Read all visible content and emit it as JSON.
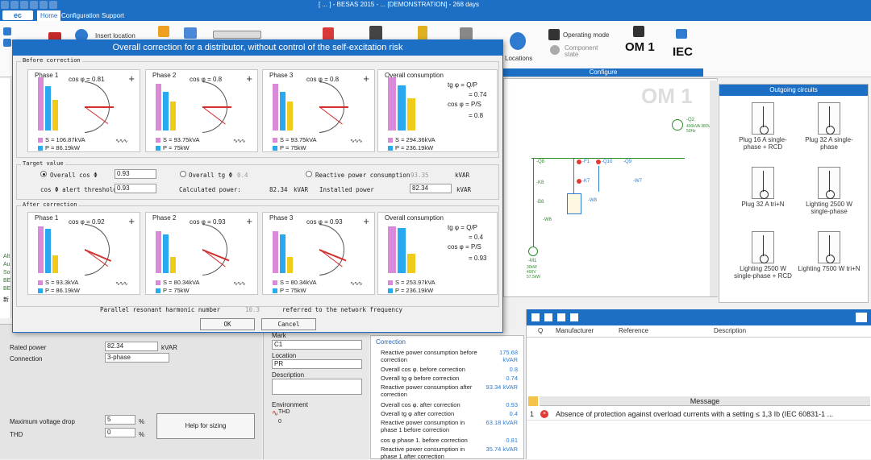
{
  "window": {
    "title": "[ ... ] - BESAS 2015 - ... [DEMONSTRATION] - 268 days"
  },
  "menu": {
    "logo": "ec",
    "home": "Home",
    "configuration": "Configuration",
    "support": "Support"
  },
  "ribbon": {
    "insert_location": "Insert location",
    "locations": "Locations",
    "operating_mode": "Operating mode",
    "component_state": "Component state",
    "om1": "OM 1",
    "iec": "IEC",
    "configure": "Configure"
  },
  "canvas": {
    "watermark": "OM 1",
    "labels": {
      "q8": "-Q8",
      "f1": "-F1",
      "q10": "-Q10",
      "q9": "-Q9",
      "k8": "-K8",
      "k7": "-K7",
      "w8": "-W8",
      "w7": "-W7",
      "b8": "-B8",
      "w6": "-W6",
      "m1": "-M1",
      "q2": "-Q2",
      "q2spec": "400kVA 380V 50Hz",
      "motor": "30kW 400V 57.5kW"
    }
  },
  "left_panel": {
    "labels": [
      "Alt",
      "Au",
      "So",
      "BE",
      "BE",
      "新"
    ]
  },
  "outgoing": {
    "title": "Outgoing circuits",
    "items": [
      "Plug 16 A single-phase + RCD",
      "Plug 32 A single-phase",
      "Plug 32 A tri+N",
      "Lighting 2500 W single-phase",
      "Lighting 2500 W single-phase + RCD",
      "Lighting 7500 W tri+N"
    ]
  },
  "dialog": {
    "title": "Overall correction for a distributor, without control of the self-excitation risk",
    "before_label": "Before correction",
    "target_label": "Target value",
    "after_label": "After correction",
    "before": [
      {
        "name": "Phase 1",
        "cos": "cos φ = 0.81",
        "s": "S = 106.87kVA",
        "p": "P = 86.19kW"
      },
      {
        "name": "Phase 2",
        "cos": "cos φ = 0.8",
        "s": "S = 93.75kVA",
        "p": "P = 75kW"
      },
      {
        "name": "Phase 3",
        "cos": "cos φ = 0.8",
        "s": "S = 93.75kVA",
        "p": "P = 75kW"
      }
    ],
    "before_overall": {
      "name": "Overall consumption",
      "tg_formula": "tg φ = Q/P",
      "tg_value": "= 0.74",
      "cos_formula": "cos φ = P/S",
      "cos_value": "= 0.8",
      "s": "S = 294.36kVA",
      "p": "P = 236.19kW"
    },
    "after": [
      {
        "name": "Phase 1",
        "cos": "cos φ = 0.92",
        "s": "S = 93.3kVA",
        "p": "P = 86.19kW"
      },
      {
        "name": "Phase 2",
        "cos": "cos φ = 0.93",
        "s": "S = 80.34kVA",
        "p": "P = 75kW"
      },
      {
        "name": "Phase 3",
        "cos": "cos φ = 0.93",
        "s": "S = 80.34kVA",
        "p": "P = 75kW"
      }
    ],
    "after_overall": {
      "name": "Overall consumption",
      "tg_formula": "tg φ = Q/P",
      "tg_value": "= 0.4",
      "cos_formula": "cos φ = P/S",
      "cos_value": "= 0.93",
      "s": "S = 253.97kVA",
      "p": "P = 236.19kW"
    },
    "target": {
      "overall_cos_label": "Overall cos Φ",
      "overall_cos_value": "0.93",
      "overall_tg_label": "Overall tg Φ",
      "overall_tg_value": "0.4",
      "reactive_label": "Reactive power consumption",
      "reactive_value": "93.35",
      "kvar": "kVAR",
      "alert_label": "cos Φ alert threshold",
      "alert_value": "0.93",
      "calc_label": "Calculated power:",
      "calc_value": "82.34",
      "calc_unit": "kVAR",
      "installed_label": "Installed power",
      "installed_value": "82.34",
      "installed_unit": "kVAR"
    },
    "harmonic_label": "Parallel resonant harmonic number",
    "harmonic_value": "10.3",
    "harmonic_suffix": "referred to the network frequency",
    "ok": "OK",
    "cancel": "Cancel"
  },
  "properties": {
    "rated_power_label": "Rated power",
    "rated_power_value": "82.34",
    "rated_power_unit": "kVAR",
    "connection_label": "Connection",
    "connection_value": "3-phase",
    "max_vd_label": "Maximum voltage drop",
    "max_vd_value": "5",
    "pct": "%",
    "thd_label": "THD",
    "thd_value": "0",
    "help_button": "Help for sizing"
  },
  "mid_panel": {
    "mark_label": "Mark",
    "mark_value": "C1",
    "location_label": "Location",
    "location_value": "PR",
    "description_label": "Description",
    "environment_label": "Environment",
    "thd_label": "THD",
    "thd_value": "0"
  },
  "correction": {
    "title": "Correction",
    "rows": [
      {
        "label": "Reactive power consumption before correction",
        "value": "175.68 kVAR"
      },
      {
        "label": "Overall cos φ. before correction",
        "value": "0.8"
      },
      {
        "label": "Overall tg φ before correction",
        "value": "0.74"
      },
      {
        "label": "Reactive power consumption after correction",
        "value": "93.34 kVAR"
      },
      {
        "label": "Overall cos φ. after correction",
        "value": "0.93"
      },
      {
        "label": "Overall tg φ after correction",
        "value": "0.4"
      },
      {
        "label": "Reactive power consumption in phase 1 before correction",
        "value": "63.18 kVAR"
      },
      {
        "label": "cos φ phase 1. before correction",
        "value": "0.81"
      },
      {
        "label": "Reactive power consumption in phase 1 after correction",
        "value": "35.74 kVAR"
      }
    ]
  },
  "grid": {
    "col_q": "Q",
    "col_manufacturer": "Manufacturer",
    "col_reference": "Reference",
    "col_description": "Description",
    "message_header": "Message",
    "msg_index": "1",
    "message": "Absence of protection against overload currents with a setting ≤ 1,3 Ib (IEC 60831-1 ..."
  },
  "colors": {
    "accent": "#1c6fc4",
    "bar_s": "#d98ad8",
    "bar_p": "#29a9f0",
    "bar_q": "#f0cc1a",
    "error": "#e53935"
  }
}
